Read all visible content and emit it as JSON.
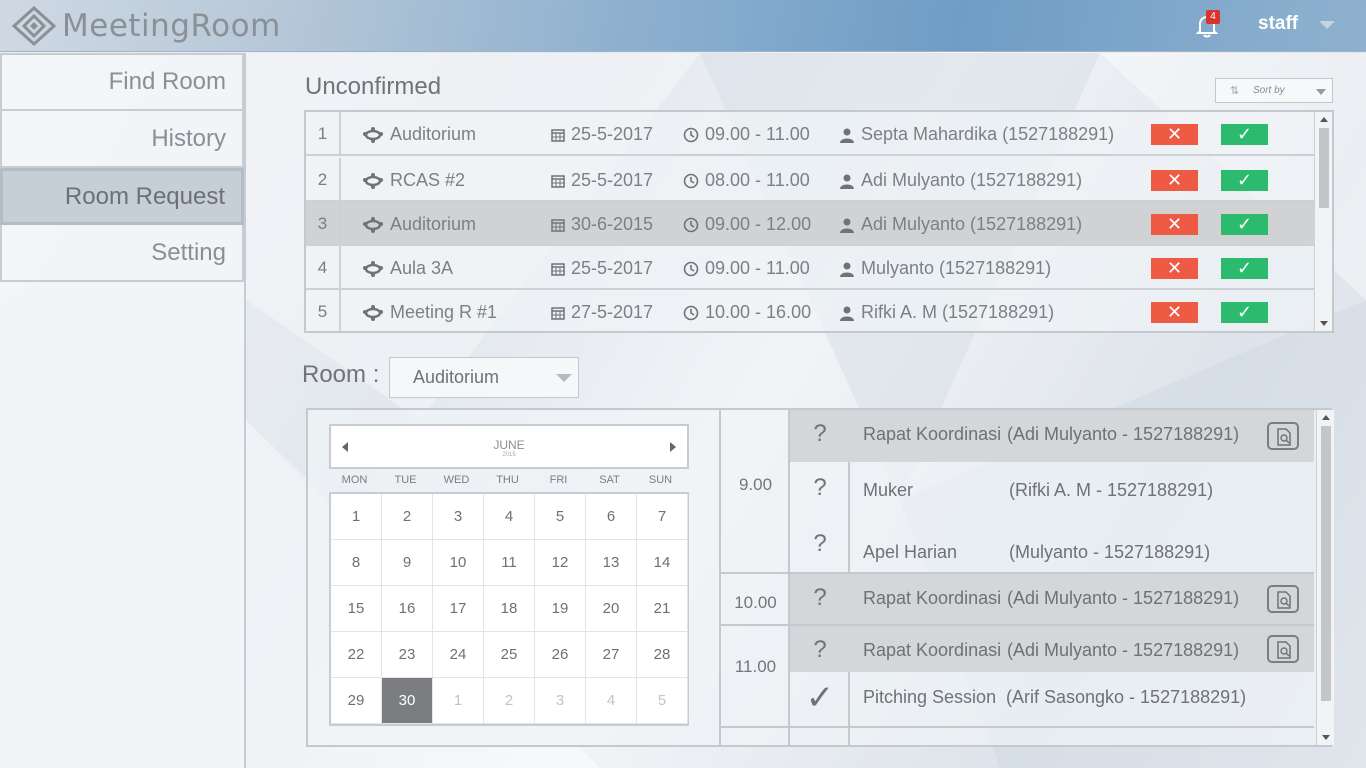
{
  "app": {
    "name": "MeetingRoom"
  },
  "header": {
    "notification_count": "4",
    "user": "staff"
  },
  "sidebar": {
    "items": [
      {
        "label": "Find Room"
      },
      {
        "label": "History"
      },
      {
        "label": "Room Request",
        "active": true
      },
      {
        "label": "Setting"
      }
    ]
  },
  "unconfirmed": {
    "title": "Unconfirmed",
    "sort_label": "Sort by",
    "rows": [
      {
        "num": "1",
        "room": "Auditorium",
        "date": "25-5-2017",
        "time": "09.00 - 11.00",
        "requester": "Septa Mahardika (1527188291)"
      },
      {
        "num": "2",
        "room": "RCAS #2",
        "date": "25-5-2017",
        "time": "08.00 - 11.00",
        "requester": "Adi Mulyanto (1527188291)"
      },
      {
        "num": "3",
        "room": "Auditorium",
        "date": "30-6-2015",
        "time": "09.00 - 12.00",
        "requester": "Adi Mulyanto (1527188291)",
        "selected": true
      },
      {
        "num": "4",
        "room": "Aula 3A",
        "date": "25-5-2017",
        "time": "09.00 - 11.00",
        "requester": "Mulyanto (1527188291)"
      },
      {
        "num": "5",
        "room": "Meeting R #1",
        "date": "27-5-2017",
        "time": "10.00 - 16.00",
        "requester": "Rifki A. M (1527188291)"
      }
    ],
    "reject_symbol": "✕",
    "accept_symbol": "✓"
  },
  "room": {
    "label": "Room :",
    "selected": "Auditorium"
  },
  "calendar": {
    "month": "JUNE",
    "year": "2015",
    "weekdays": [
      "MON",
      "TUE",
      "WED",
      "THU",
      "FRI",
      "SAT",
      "SUN"
    ],
    "days": [
      "1",
      "2",
      "3",
      "4",
      "5",
      "6",
      "7",
      "8",
      "9",
      "10",
      "11",
      "12",
      "13",
      "14",
      "15",
      "16",
      "17",
      "18",
      "19",
      "20",
      "21",
      "22",
      "23",
      "24",
      "25",
      "26",
      "27",
      "28",
      "29",
      "30",
      "1",
      "2",
      "3",
      "4",
      "5"
    ],
    "selected_day": "30"
  },
  "schedule": {
    "times": [
      "9.00",
      "10.00",
      "11.00"
    ],
    "events": [
      {
        "status": "?",
        "title": "Rapat Koordinasi",
        "person": "(Adi Mulyanto - 1527188291)",
        "has_doc": true
      },
      {
        "status": "?",
        "title": "Muker",
        "person": "(Rifki A. M - 1527188291)",
        "has_doc": false
      },
      {
        "status": "?",
        "title": "Apel Harian",
        "person": "(Mulyanto - 1527188291)",
        "has_doc": false
      },
      {
        "status": "?",
        "title": "Rapat Koordinasi",
        "person": "(Adi Mulyanto - 1527188291)",
        "has_doc": true
      },
      {
        "status": "?",
        "title": "Rapat Koordinasi",
        "person": "(Adi Mulyanto - 1527188291)",
        "has_doc": true
      },
      {
        "status": "✓",
        "title": "Pitching Session",
        "person": "(Arif Sasongko - 1527188291)",
        "has_doc": false
      }
    ]
  },
  "colors": {
    "reject": "#ef5a44",
    "accept": "#2cba6e",
    "badge": "#d9342b",
    "selected_row": "#d0d2d4",
    "selected_day": "#7b7d80"
  }
}
